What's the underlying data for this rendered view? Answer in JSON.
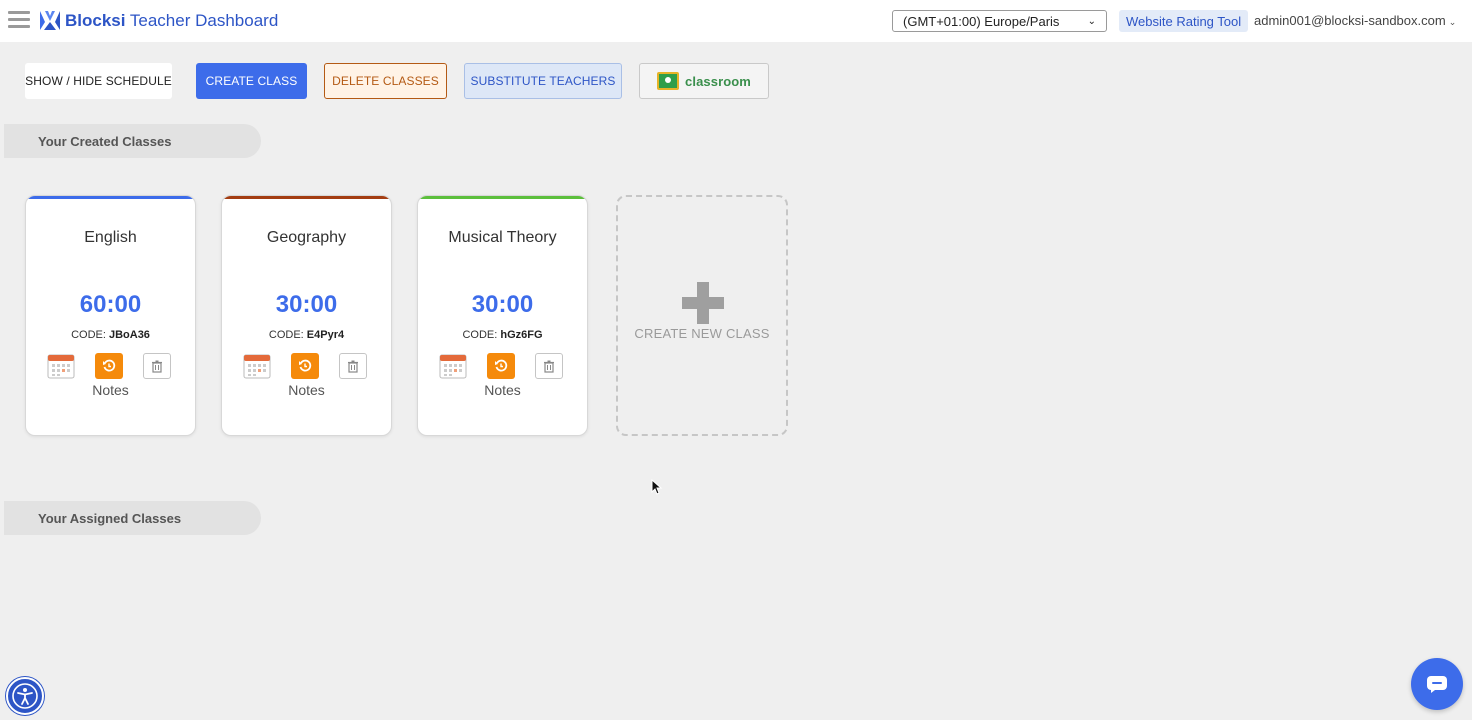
{
  "header": {
    "app_name_bold": "Blocksi",
    "app_name_rest": " Teacher Dashboard",
    "timezone": "(GMT+01:00) Europe/Paris",
    "rating_tool": "Website Rating Tool",
    "user": "admin001@blocksi-sandbox.com"
  },
  "toolbar": {
    "schedule": "SHOW / HIDE SCHEDULE",
    "create": "CREATE CLASS",
    "delete": "DELETE CLASSES",
    "substitute": "SUBSTITUTE TEACHERS",
    "classroom": "classroom"
  },
  "sections": {
    "created": "Your Created Classes",
    "assigned": "Your Assigned Classes"
  },
  "classes": [
    {
      "name": "English",
      "time": "60:00",
      "code_label": "CODE:",
      "code": "JBoA36",
      "notes": "Notes",
      "accent": "#3d6cea"
    },
    {
      "name": "Geography",
      "time": "30:00",
      "code_label": "CODE:",
      "code": "E4Pyr4",
      "notes": "Notes",
      "accent": "#a33d12"
    },
    {
      "name": "Musical Theory",
      "time": "30:00",
      "code_label": "CODE:",
      "code": "hGz6FG",
      "notes": "Notes",
      "accent": "#5cbf3c"
    }
  ],
  "new_class": "CREATE NEW CLASS",
  "colors": {
    "primary": "#3d6cea",
    "orange": "#f58a0b",
    "background": "#efefef"
  },
  "icons": [
    "hamburger-icon",
    "blocksi-logo-icon",
    "calendar-icon",
    "reset-icon",
    "trash-icon",
    "plus-icon",
    "accessibility-icon",
    "chat-icon"
  ]
}
